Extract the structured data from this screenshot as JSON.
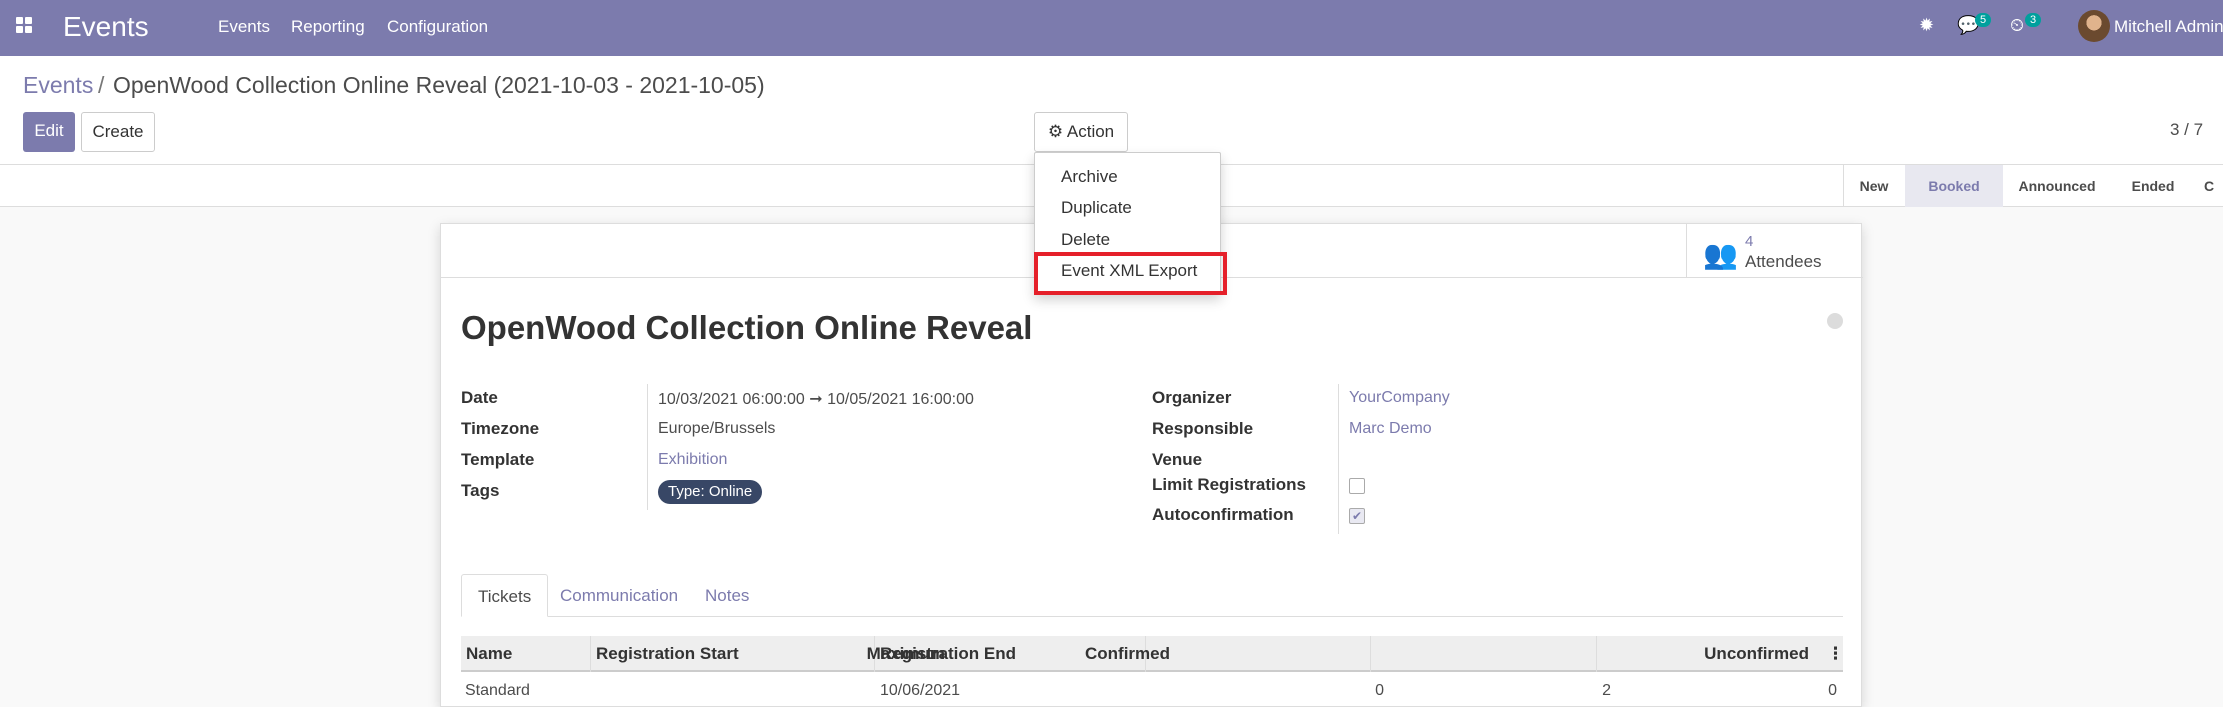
{
  "navbar": {
    "app_name": "Events",
    "menu": [
      "Events",
      "Reporting",
      "Configuration"
    ],
    "messages_count": "5",
    "activities_count": "3",
    "user_name": "Mitchell Admin",
    "icons": [
      "apps-grid-icon",
      "bug-icon",
      "chat-icon",
      "clock-icon"
    ]
  },
  "breadcrumb": {
    "parent": "Events",
    "separator": "/",
    "current": "OpenWood Collection Online Reveal (2021-10-03 - 2021-10-05)"
  },
  "buttons": {
    "edit": "Edit",
    "create": "Create",
    "action": "Action"
  },
  "pager": "3 / 7",
  "action_menu": [
    "Archive",
    "Duplicate",
    "Delete",
    "Event XML Export"
  ],
  "stages": [
    "New",
    "Booked",
    "Announced",
    "Ended",
    "C"
  ],
  "current_stage": "Booked",
  "smart_button": {
    "count": "4",
    "label": "Attendees"
  },
  "event": {
    "name": "OpenWood Collection Online Reveal",
    "left_fields": [
      {
        "label": "Date",
        "value": "10/03/2021 06:00:00  ➞  10/05/2021 16:00:00"
      },
      {
        "label": "Timezone",
        "value": "Europe/Brussels"
      },
      {
        "label": "Template",
        "value": "Exhibition"
      },
      {
        "label": "Tags",
        "value": "Type: Online"
      }
    ],
    "right_fields": [
      {
        "label": "Organizer",
        "value": "YourCompany"
      },
      {
        "label": "Responsible",
        "value": "Marc Demo"
      },
      {
        "label": "Venue",
        "value": ""
      },
      {
        "label": "Limit Registrations",
        "value": false
      },
      {
        "label": "Autoconfirmation",
        "value": true
      }
    ]
  },
  "tabs": [
    "Tickets",
    "Communication",
    "Notes"
  ],
  "tickets": {
    "columns": [
      "Name",
      "Registration Start",
      "Registration End",
      "Maximum",
      "Confirmed",
      "Unconfirmed"
    ],
    "rows": [
      [
        "Standard",
        "",
        "10/06/2021",
        "0",
        "2",
        "0"
      ]
    ]
  },
  "colors": {
    "brand": "#7c7bad",
    "highlight": "#e5202a",
    "tag": "#384766",
    "badge": "#00a09d"
  }
}
